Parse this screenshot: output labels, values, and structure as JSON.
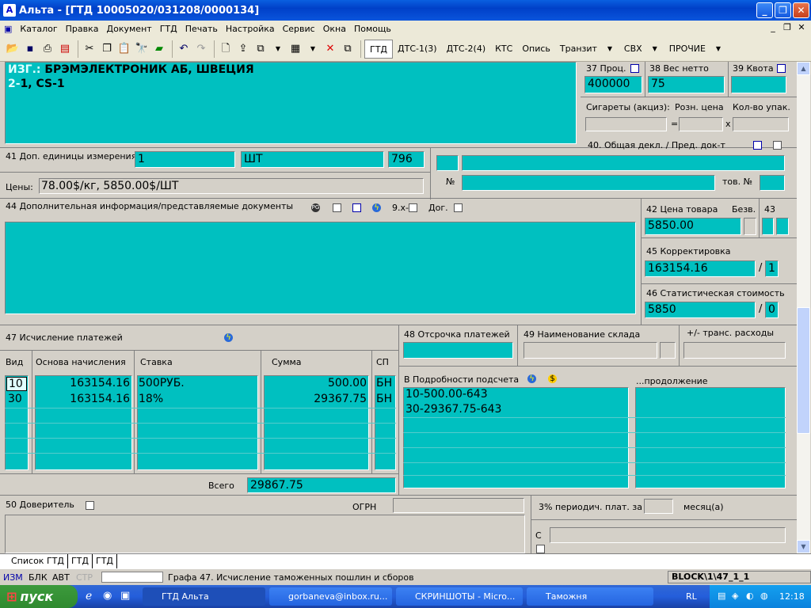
{
  "window": {
    "title": "Альта - [ГТД 10005020/031208/0000134]",
    "app_icon": "А"
  },
  "menu": [
    "Каталог",
    "Правка",
    "Документ",
    "ГТД",
    "Печать",
    "Настройка",
    "Сервис",
    "Окна",
    "Помощь"
  ],
  "toolbar": {
    "text_buttons": [
      "ГТД",
      "ДТС-1(3)",
      "ДТС-2(4)",
      "КТС",
      "Опись",
      "Транзит",
      "СВХ",
      "ПРОЧИЕ"
    ]
  },
  "box_top": {
    "prefix": "ИЗГ.:",
    "maker": "БРЭМЭЛЕКТРОНИК АБ, ШВЕЦИЯ",
    "line2_prefix": "2-",
    "line2": "1, CS-1"
  },
  "b37": {
    "label": "37 Проц.",
    "value": "400000"
  },
  "b38": {
    "label": "38 Вес нетто",
    "value": "75"
  },
  "b39": {
    "label": "39 Квота",
    "value": ""
  },
  "cig": {
    "label1": "Сигареты (акциз):",
    "label2": "Розн. цена",
    "label3": "Кол-во упак.",
    "eq": "=",
    "x": "x"
  },
  "b41": {
    "label": "41 Доп. единицы измерения",
    "qty": "1",
    "unit": "ШТ",
    "code": "796"
  },
  "b40": {
    "label": "40. Общая декл. / Пред. док-т",
    "no_label": "№",
    "tov_label": "тов. №"
  },
  "prices": {
    "label": "Цены:",
    "value": "78.00$/кг,  5850.00$/ШТ"
  },
  "b44": {
    "label": "44 Дополнительная информация/представляемые документы",
    "tool1": "9.х-",
    "tool2": "Дог."
  },
  "b42": {
    "label": "42 Цена товара",
    "value": "5850.00",
    "bezv": "Безв."
  },
  "b43": {
    "label": "43"
  },
  "b45": {
    "label": "45 Корректировка",
    "value": "163154.16",
    "slash": "/",
    "method": "1"
  },
  "b46": {
    "label": "46 Статистическая стоимость",
    "value": "5850",
    "slash": "/",
    "method": "0"
  },
  "b47": {
    "label": "47 Исчисление платежей",
    "headers": [
      "Вид",
      "Основа начисления",
      "Ставка",
      "Сумма",
      "СП"
    ],
    "rows": [
      [
        "10",
        "163154.16",
        "500РУБ.",
        "500.00",
        "БН"
      ],
      [
        "30",
        "163154.16",
        "18%",
        "29367.75",
        "БН"
      ]
    ],
    "total_label": "Всего",
    "total": "29867.75"
  },
  "b48": {
    "label": "48 Отсрочка платежей"
  },
  "b49": {
    "label": "49 Наименование склада"
  },
  "trans": {
    "label": "+/-  транс. расходы"
  },
  "podr": {
    "label": "В Подробности подсчета",
    "lines": [
      "10-500.00-643",
      "30-29367.75-643"
    ],
    "cont_label": "...продолжение"
  },
  "b50": {
    "label": "50 Доверитель",
    "ogrn": "ОГРН"
  },
  "periodic": {
    "label": "3% периодич. плат. за",
    "unit": "месяц(а)"
  },
  "sign": {
    "label": "С"
  },
  "tabs": [
    "Список ГТД",
    "ГТД",
    "ГТД"
  ],
  "status": {
    "items": [
      "ИЗМ",
      "БЛК",
      "АВТ",
      "СТР"
    ],
    "message": "Графа 47. Исчисление таможенных пошлин и сборов",
    "block": "BLOCK\\1\\47_1_1"
  },
  "taskbar": {
    "start": "пуск",
    "tasks": [
      "ГТД Альта",
      "gorbaneva@inbox.ru...",
      "СКРИНШОТЫ - Micro...",
      "Таможня"
    ],
    "lang": "RL",
    "time": "12:18"
  }
}
